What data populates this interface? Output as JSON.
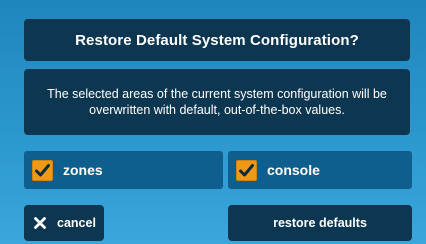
{
  "dialog": {
    "title": "Restore Default System Configuration?",
    "message": "The selected areas of the current system configuration will be overwritten with default, out-of-the-box values."
  },
  "options": [
    {
      "label": "zones",
      "checked": true
    },
    {
      "label": "console",
      "checked": true
    }
  ],
  "buttons": {
    "cancel_label": "cancel",
    "cancel_icon": "close-icon",
    "restore_label": "restore defaults"
  },
  "colors": {
    "panel": "#0d3650",
    "background": "#2b97cf",
    "option_background": "#0f5f8e",
    "checkbox": "#ef9a16"
  }
}
